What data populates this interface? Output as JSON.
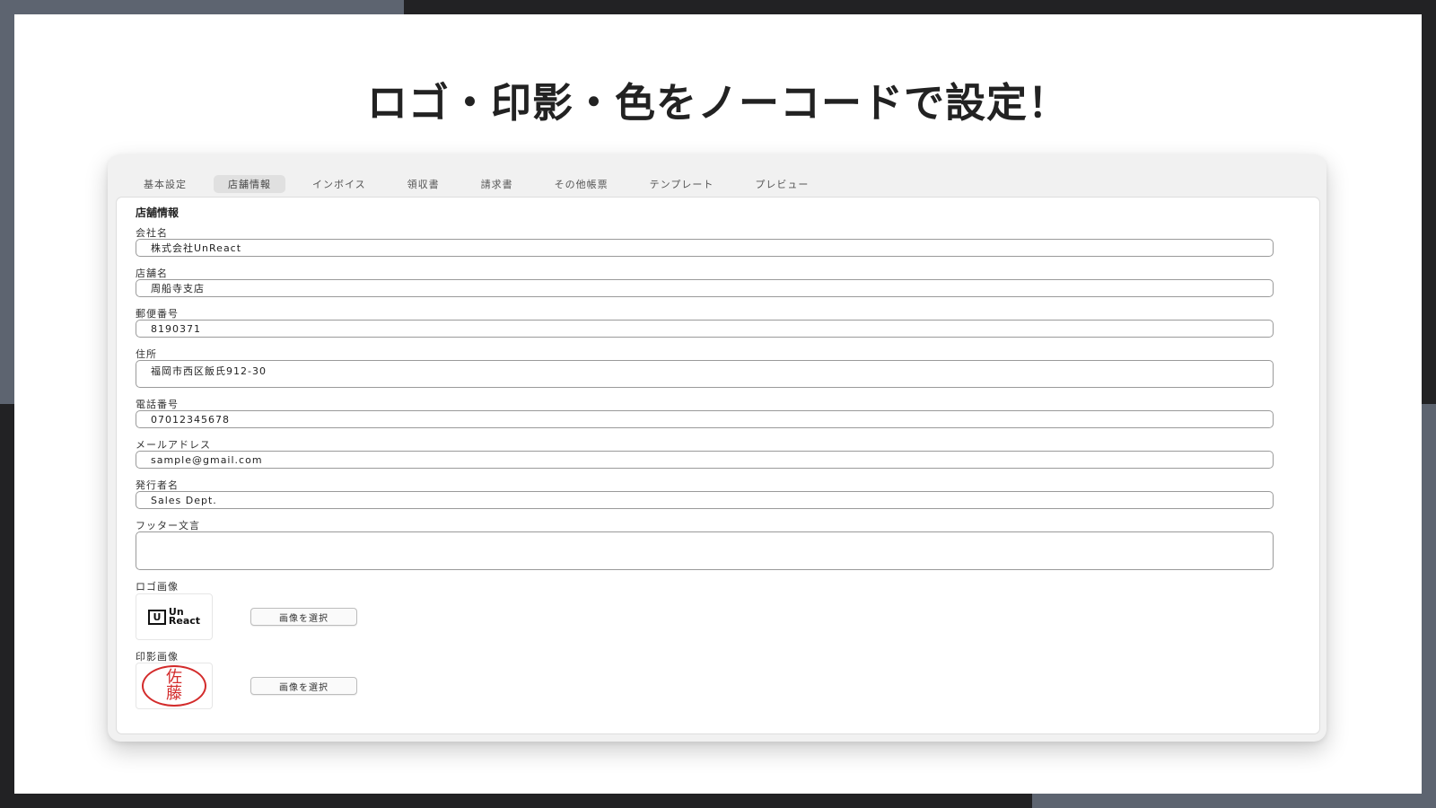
{
  "headline": "ロゴ・印影・色をノーコードで設定！",
  "tabs": [
    {
      "label": "基本設定"
    },
    {
      "label": "店舗情報"
    },
    {
      "label": "インボイス"
    },
    {
      "label": "領収書"
    },
    {
      "label": "請求書"
    },
    {
      "label": "その他帳票"
    },
    {
      "label": "テンプレート"
    },
    {
      "label": "プレビュー"
    }
  ],
  "active_tab": "店舗情報",
  "form": {
    "title": "店舗情報",
    "company_name": {
      "label": "会社名",
      "value": "株式会社UnReact"
    },
    "store_name": {
      "label": "店舗名",
      "value": "周船寺支店"
    },
    "postal_code": {
      "label": "郵便番号",
      "value": "8190371"
    },
    "address": {
      "label": "住所",
      "value": "福岡市西区飯氏912-30"
    },
    "phone": {
      "label": "電話番号",
      "value": "07012345678"
    },
    "email": {
      "label": "メールアドレス",
      "value": "sample@gmail.com"
    },
    "issuer": {
      "label": "発行者名",
      "value": "Sales Dept."
    },
    "footer": {
      "label": "フッター文言",
      "value": ""
    },
    "logo": {
      "label": "ロゴ画像",
      "button": "画像を選択",
      "brand_box": "U",
      "brand_line1": "Un",
      "brand_line2": "React"
    },
    "seal": {
      "label": "印影画像",
      "button": "画像を選択",
      "char1": "佐",
      "char2": "藤",
      "color": "#d32b2b"
    }
  }
}
